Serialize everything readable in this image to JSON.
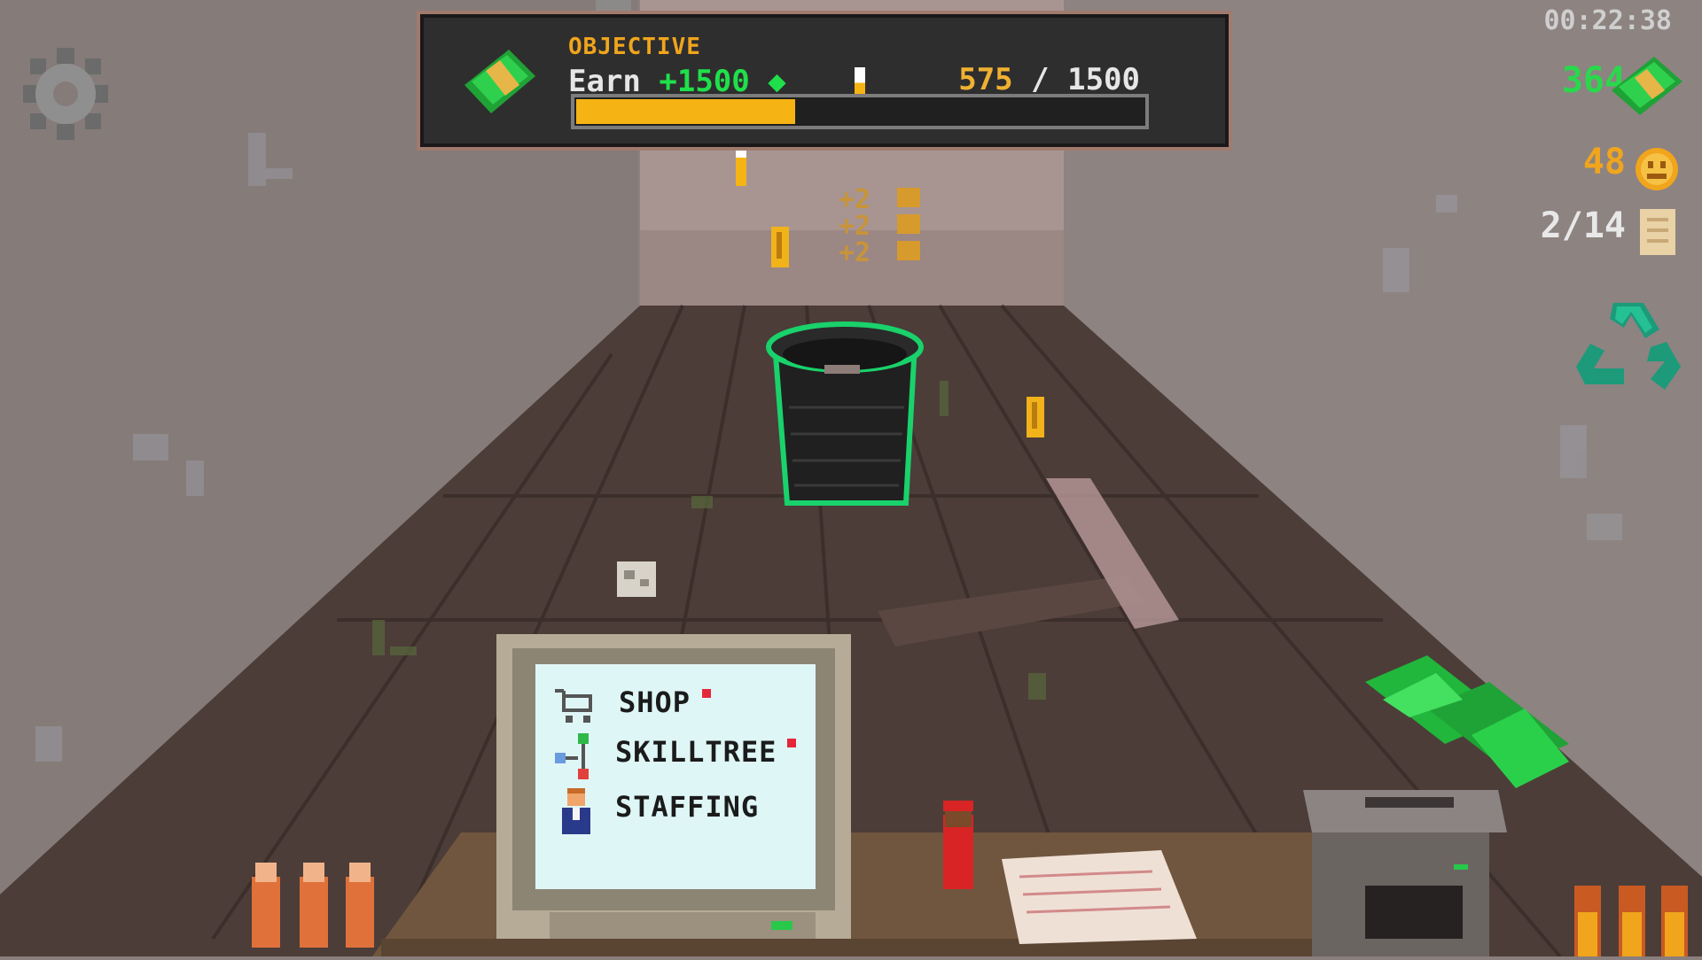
{
  "hud": {
    "objective_title": "OBJECTIVE",
    "objective_verb": "Earn",
    "objective_amount": "+1500",
    "progress_current": "575",
    "progress_separator": "/",
    "progress_target": "1500",
    "progress_fraction": 0.383,
    "timer": "00:22:38",
    "cash": "364",
    "coins": "48",
    "pages": "2/14"
  },
  "popups": [
    "+2",
    "+2",
    "+2"
  ],
  "computer_menu": {
    "items": [
      {
        "label": "SHOP",
        "icon": "cart-icon",
        "has_notification": true
      },
      {
        "label": "SKILLTREE",
        "icon": "skilltree-icon",
        "has_notification": true
      },
      {
        "label": "STAFFING",
        "icon": "staff-icon",
        "has_notification": false
      }
    ]
  },
  "icons": {
    "settings": "gear-icon",
    "recycle": "recycle-icon",
    "cash": "cash-stack-icon",
    "coin": "smiley-coin-icon",
    "page": "paper-page-icon"
  },
  "colors": {
    "accent_orange": "#f6b414",
    "cash_green": "#29d84b",
    "outline_green": "#19d26b",
    "panel_bg": "#2f2e2e"
  }
}
